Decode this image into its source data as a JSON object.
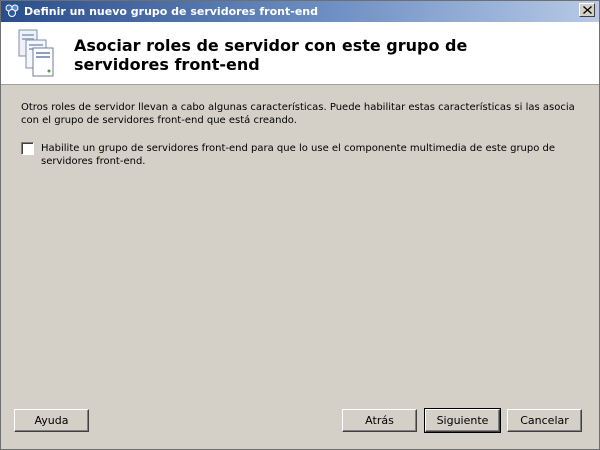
{
  "window": {
    "title": "Definir un nuevo grupo de servidores front-end",
    "close_icon": "close-icon"
  },
  "header": {
    "heading": "Asociar roles de servidor con este grupo de servidores front-end",
    "icon": "server-icon"
  },
  "content": {
    "description": "Otros roles de servidor llevan a cabo algunas características. Puede habilitar estas características si las asocia con el grupo de servidores front-end que está creando.",
    "option": {
      "label": "Habilite un grupo de servidores front-end para que lo use el componente multimedia de este grupo de servidores front-end.",
      "checked": false
    }
  },
  "buttons": {
    "help": "Ayuda",
    "back": "Atrás",
    "next": "Siguiente",
    "cancel": "Cancelar"
  },
  "colors": {
    "dialog_bg": "#d4d0c8",
    "titlebar_start": "#2a4e8c",
    "titlebar_end": "#b7c9e6"
  }
}
